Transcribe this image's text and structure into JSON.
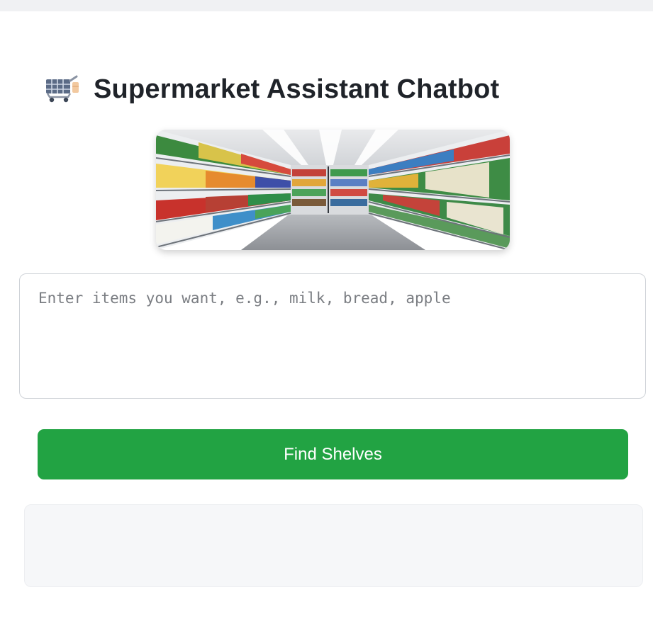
{
  "header": {
    "title": "Supermarket Assistant Chatbot",
    "icon": "shopping-cart-icon"
  },
  "hero_image": {
    "subject": "supermarket-aisle"
  },
  "input": {
    "value": "",
    "placeholder": "Enter items you want, e.g., milk, bread, apple"
  },
  "actions": {
    "find_label": "Find Shelves"
  },
  "result": {
    "text": ""
  },
  "colors": {
    "accent": "#22a343",
    "title": "#1f2329",
    "background": "#ffffff"
  }
}
